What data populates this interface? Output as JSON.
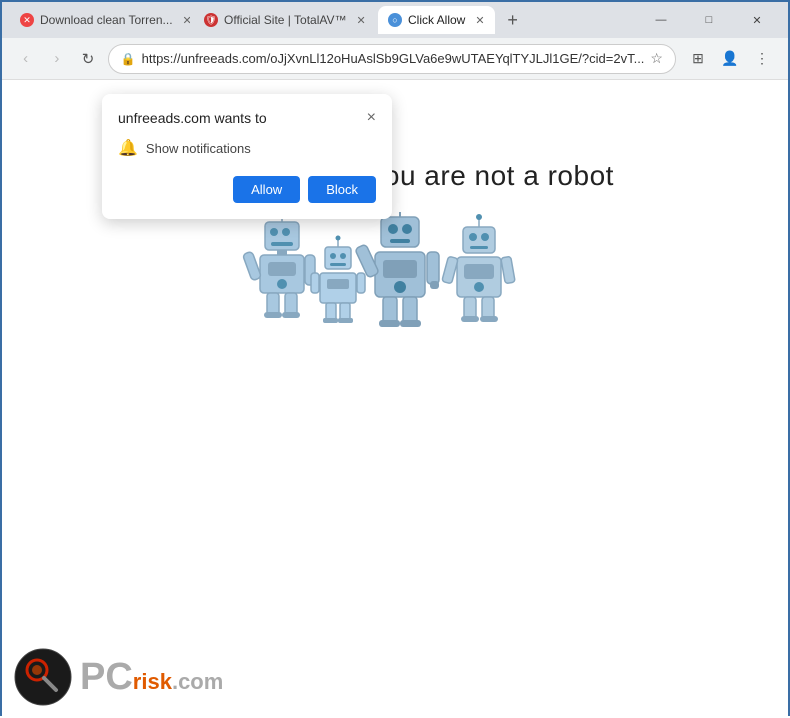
{
  "titlebar": {
    "tabs": [
      {
        "id": "tab1",
        "label": "Download clean Torren...",
        "icon_type": "red",
        "icon_text": "✕",
        "active": false
      },
      {
        "id": "tab2",
        "label": "Official Site | TotalAV™",
        "icon_type": "shield",
        "icon_text": "🛡",
        "active": false
      },
      {
        "id": "tab3",
        "label": "Click Allow",
        "icon_type": "blue",
        "icon_text": "○",
        "active": true
      }
    ],
    "new_tab_label": "+",
    "minimize": "—",
    "maximize": "□",
    "close": "✕"
  },
  "addressbar": {
    "back": "‹",
    "forward": "›",
    "refresh": "↻",
    "url": "https://unfreeads.com/oJjXvnLl12oHuAslSb9GLVa6e9wUTAEYqlTYJLJl1GE/?cid=2vT...",
    "star": "☆",
    "extensions_icon": "⊞",
    "profile_icon": "👤",
    "menu_icon": "⋮"
  },
  "notification_popup": {
    "title": "unfreeads.com wants to",
    "close": "×",
    "bell_label": "Show notifications",
    "allow_btn": "Allow",
    "block_btn": "Block"
  },
  "page": {
    "main_text": "Click \"Allow\"   if you are not   a robot"
  },
  "pcrisk": {
    "pc_text": "PC",
    "risk_text": "risk",
    "dotcom_text": ".com"
  }
}
